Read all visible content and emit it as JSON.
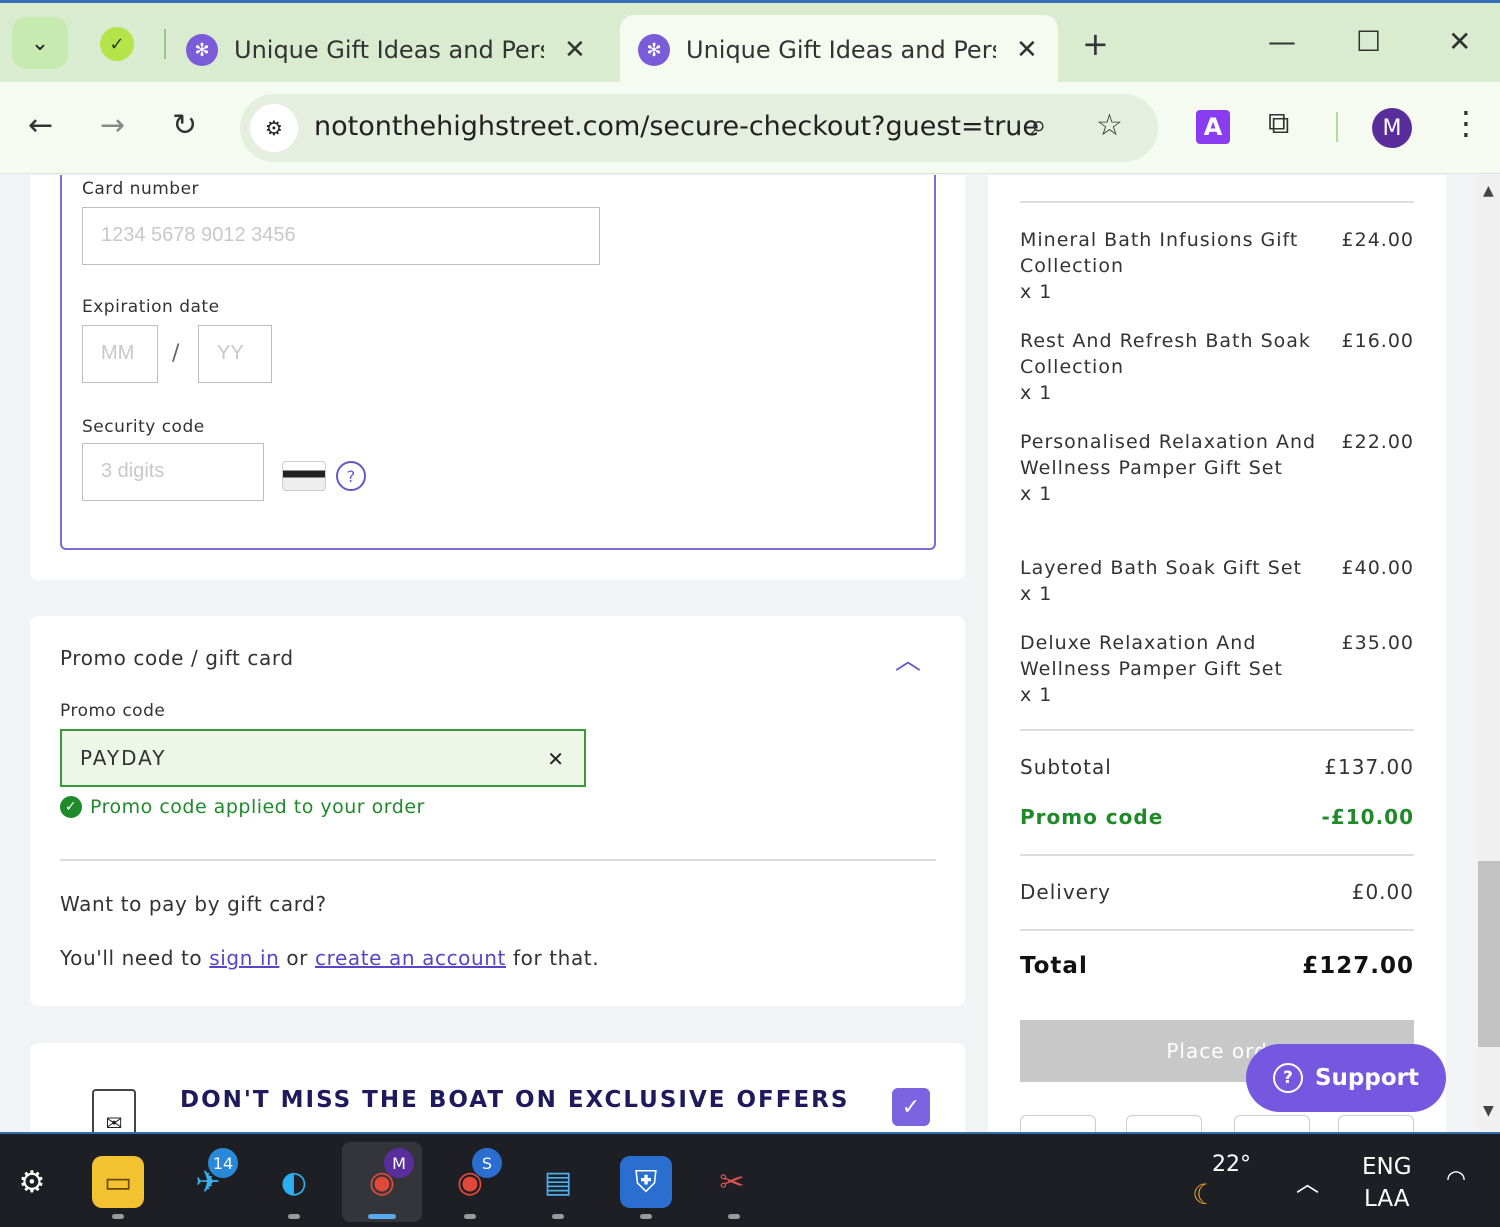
{
  "browser": {
    "tabs": [
      {
        "title": "Unique Gift Ideas and Person",
        "active": false
      },
      {
        "title": "Unique Gift Ideas and Person",
        "active": true
      }
    ],
    "url": "notonthehighstreet.com/secure-checkout?guest=true",
    "profile_initial": "M",
    "extension_letter": "A"
  },
  "payment": {
    "card_number_label": "Card number",
    "card_number_placeholder": "1234 5678 9012 3456",
    "expiration_label": "Expiration date",
    "month_placeholder": "MM",
    "year_placeholder": "YY",
    "date_separator": "/",
    "security_label": "Security code",
    "security_placeholder": "3 digits",
    "help_glyph": "?"
  },
  "promo": {
    "section_title": "Promo code / gift card",
    "field_label": "Promo code",
    "value": "PAYDAY",
    "success_message": "Promo code applied to your order",
    "gift_question": "Want to pay by gift card?",
    "gift_text_prefix": "You'll need to",
    "sign_in_link": "sign in",
    "or_text": "or",
    "create_account_link": "create an account",
    "gift_text_suffix": "for that."
  },
  "offers": {
    "title": "DON'T MISS THE BOAT ON EXCLUSIVE OFFERS",
    "checked": true
  },
  "summary": {
    "items": [
      {
        "name": "Mineral Bath Infusions Gift Collection",
        "qty": "x 1",
        "price": "£24.00"
      },
      {
        "name": "Rest And Refresh Bath Soak Collection",
        "qty": "x 1",
        "price": "£16.00"
      },
      {
        "name": "Personalised Relaxation And Wellness Pamper Gift Set",
        "qty": "x 1",
        "price": "£22.00"
      },
      {
        "name": "Layered Bath Soak Gift Set",
        "qty": "x 1",
        "price": "£40.00"
      },
      {
        "name": "Deluxe Relaxation And Wellness Pamper Gift Set",
        "qty": "x 1",
        "price": "£35.00"
      }
    ],
    "subtotal_label": "Subtotal",
    "subtotal_value": "£137.00",
    "promo_label": "Promo code",
    "promo_value": "-£10.00",
    "delivery_label": "Delivery",
    "delivery_value": "£0.00",
    "total_label": "Total",
    "total_value": "£127.00",
    "place_order_label": "Place ord"
  },
  "support": {
    "label": "Support"
  },
  "taskbar": {
    "telegram_badge": "14",
    "chrome_profile_badge": "M",
    "chrome_second_badge": "S",
    "temperature": "22°",
    "language_line1": "ENG",
    "language_line2": "LAA"
  },
  "colors": {
    "accent": "#7557e0",
    "success": "#1f8a2a",
    "tabbar": "#d9ecd0"
  }
}
